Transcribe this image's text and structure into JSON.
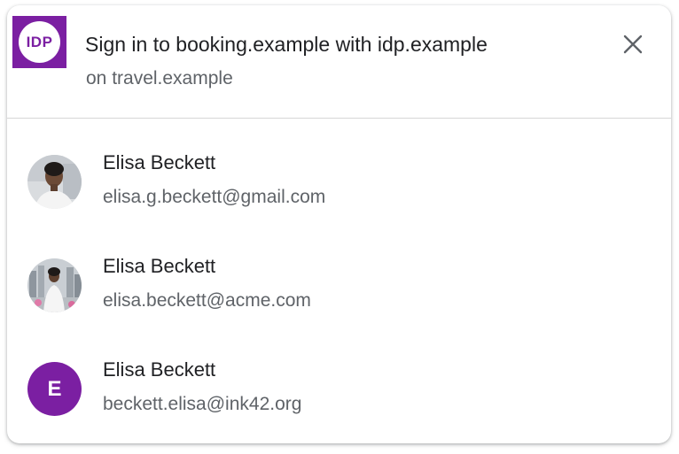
{
  "header": {
    "logo_text": "IDP",
    "title": "Sign in to booking.example with idp.example",
    "subtitle": "on travel.example",
    "close_icon": "close-icon"
  },
  "accounts": [
    {
      "name": "Elisa Beckett",
      "email": "elisa.g.beckett@gmail.com",
      "avatar": "photo"
    },
    {
      "name": "Elisa Beckett",
      "email": "elisa.beckett@acme.com",
      "avatar": "photo"
    },
    {
      "name": "Elisa Beckett",
      "email": "beckett.elisa@ink42.org",
      "avatar": "letter",
      "avatar_letter": "E"
    }
  ],
  "colors": {
    "brand": "#7b1fa2",
    "title_text": "#202124",
    "secondary_text": "#5f6368",
    "divider": "#d6d6d6"
  }
}
